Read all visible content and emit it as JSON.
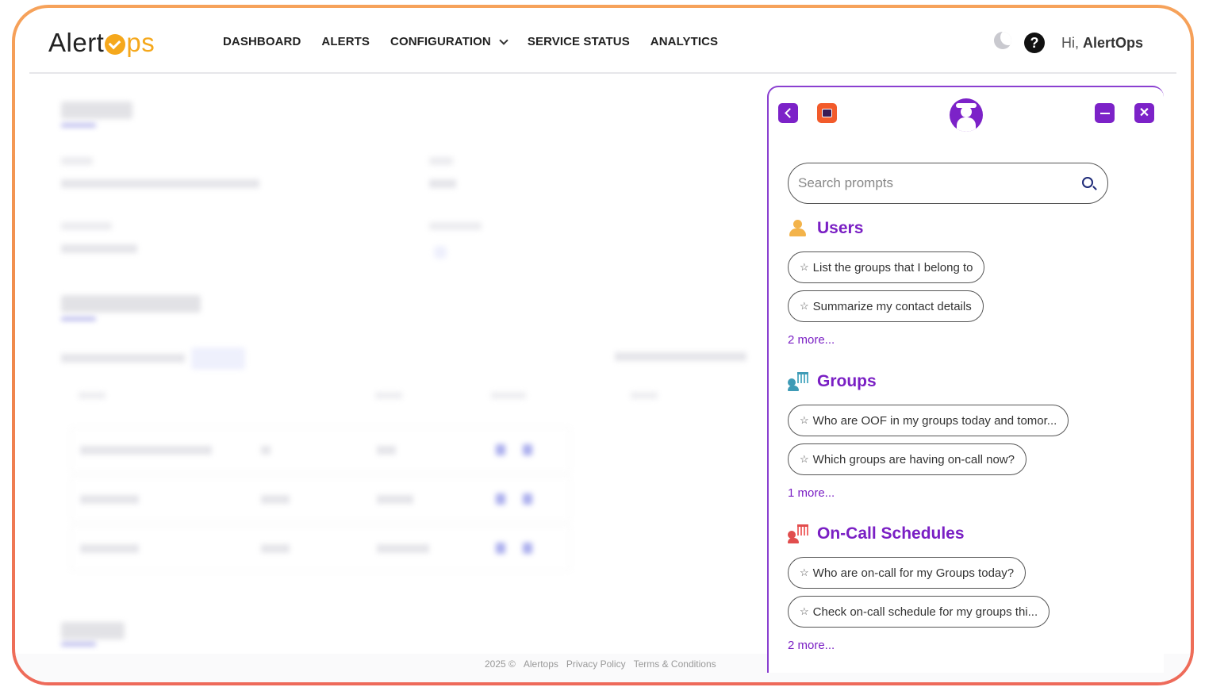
{
  "header": {
    "logo_prefix": "Alert",
    "logo_suffix": "ps",
    "nav": [
      "DASHBOARD",
      "ALERTS",
      "CONFIGURATION",
      "SERVICE STATUS",
      "ANALYTICS"
    ],
    "greeting_prefix": "Hi, ",
    "greeting_name": "AlertOps",
    "help_glyph": "?"
  },
  "footer": {
    "year": "2025 ©",
    "brand": "Alertops",
    "privacy": "Privacy Policy",
    "terms": "Terms & Conditions"
  },
  "panel": {
    "close_glyph": "✕",
    "search": {
      "placeholder": "Search prompts",
      "value": ""
    },
    "sections": [
      {
        "title": "Users",
        "icon": "user-icon",
        "prompts": [
          "List the groups that I belong to",
          "Summarize my contact details"
        ],
        "more": "2 more..."
      },
      {
        "title": "Groups",
        "icon": "group-icon",
        "prompts": [
          "Who are OOF in my groups today and tomor...",
          "Which groups are having on-call now?"
        ],
        "more": "1 more..."
      },
      {
        "title": "On-Call Schedules",
        "icon": "schedule-icon",
        "prompts": [
          "Who are on-call for my Groups today?",
          "Check on-call schedule for my groups thi..."
        ],
        "more": "2 more..."
      }
    ]
  },
  "colors": {
    "accent": "#7a1fc4",
    "brand_orange": "#f5a81c",
    "frame_gradient_top": "#f6a25a",
    "frame_gradient_bottom": "#ee6a5a"
  }
}
